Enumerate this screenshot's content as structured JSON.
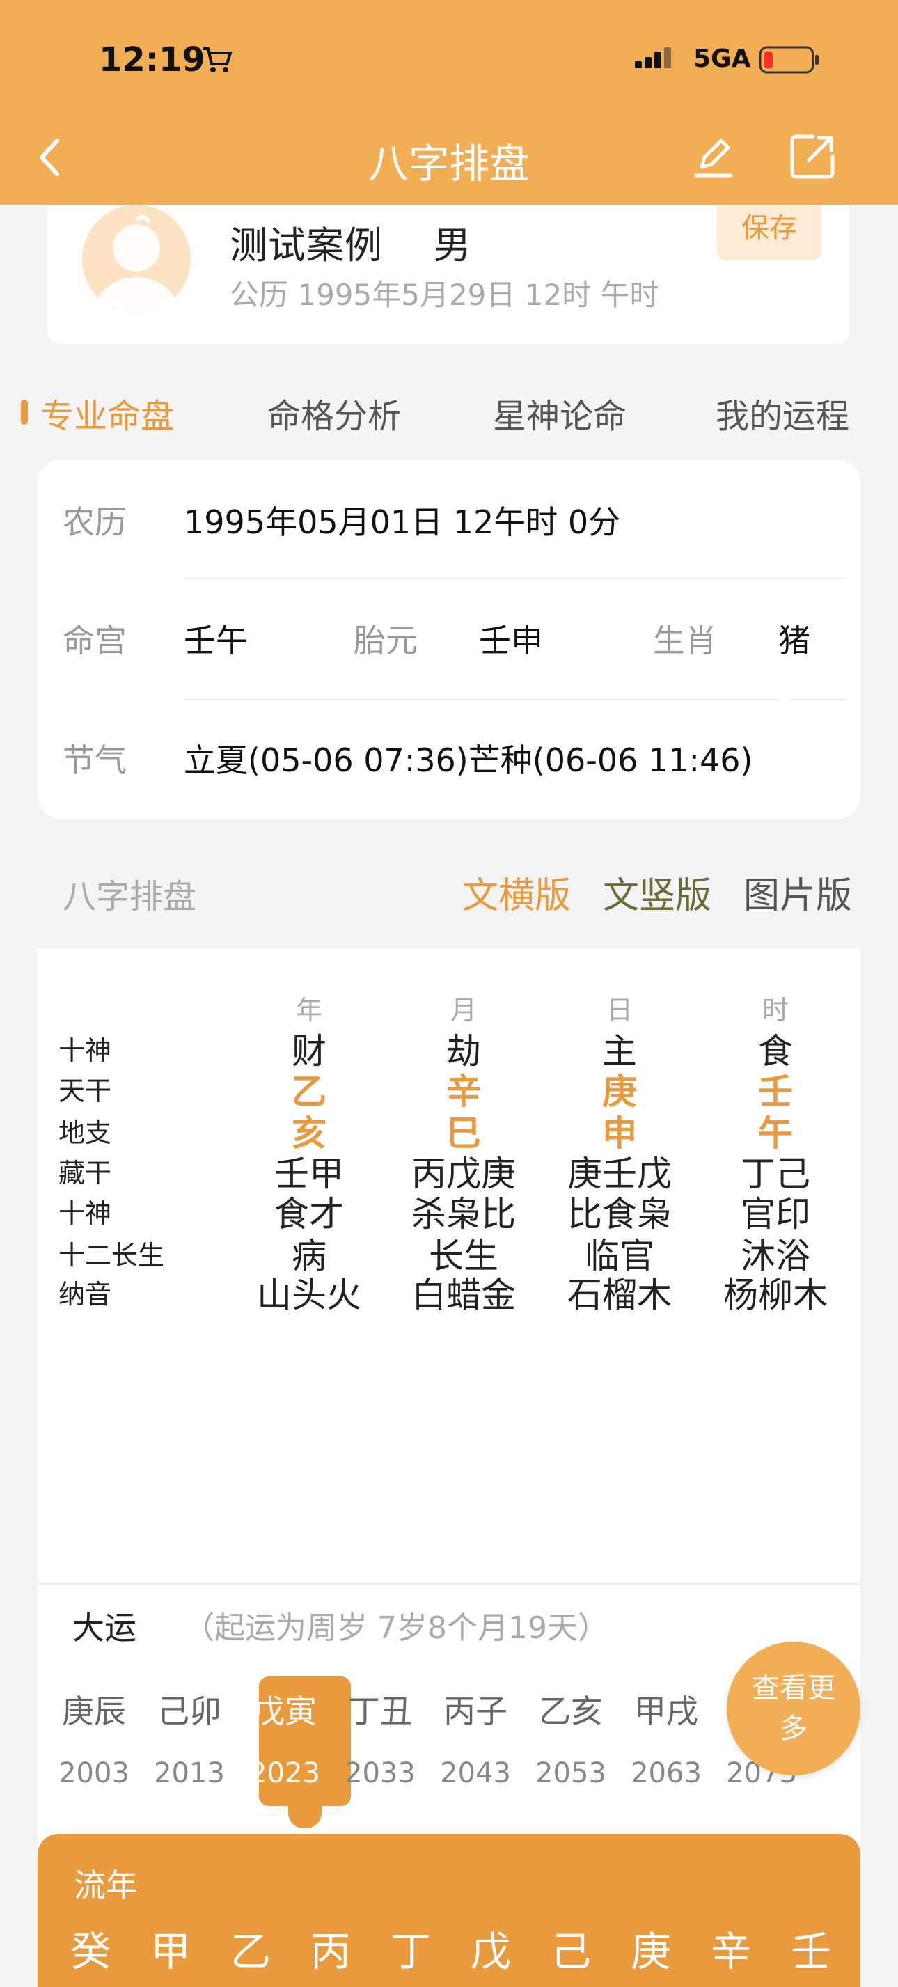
{
  "status": {
    "time": "12:19",
    "network": "5GA"
  },
  "header": {
    "title": "八字排盘"
  },
  "profile": {
    "name": "测试案例",
    "gender": "男",
    "birth": "公历 1995年5月29日 12时 午时",
    "save_label": "保存"
  },
  "tabs": [
    "专业命盘",
    "命格分析",
    "星神论命",
    "我的运程"
  ],
  "info": {
    "lunar_label": "农历",
    "lunar_value": "1995年05月01日 12午时 0分",
    "minggong_label": "命宫",
    "minggong_value": "壬午",
    "taiyuan_label": "胎元",
    "taiyuan_value": "壬申",
    "zodiac_label": "生肖",
    "zodiac_value": "猪",
    "jieqi_label": "节气",
    "jieqi_value": "立夏(05-06 07:36)芒种(06-06 11:46)"
  },
  "bazi_section": {
    "title": "八字排盘",
    "views": [
      "文横版",
      "文竖版",
      "图片版"
    ]
  },
  "bazi": {
    "columns": [
      "年",
      "月",
      "日",
      "时"
    ],
    "rows": [
      {
        "label": "十神",
        "cells": [
          "财",
          "劫",
          "主",
          "食"
        ],
        "highlight": false
      },
      {
        "label": "天干",
        "cells": [
          "乙",
          "辛",
          "庚",
          "壬"
        ],
        "highlight": true
      },
      {
        "label": "地支",
        "cells": [
          "亥",
          "巳",
          "申",
          "午"
        ],
        "highlight": true
      },
      {
        "label": "藏干",
        "cells": [
          "壬甲",
          "丙戊庚",
          "庚壬戊",
          "丁己"
        ],
        "highlight": false
      },
      {
        "label": "十神",
        "cells": [
          "食才",
          "杀枭比",
          "比食枭",
          "官印"
        ],
        "highlight": false
      },
      {
        "label": "十二长生",
        "cells": [
          "病",
          "长生",
          "临官",
          "沐浴"
        ],
        "highlight": false
      },
      {
        "label": "纳音",
        "cells": [
          "山头火",
          "白蜡金",
          "石榴木",
          "杨柳木"
        ],
        "highlight": false
      }
    ]
  },
  "dayun": {
    "title": "大运",
    "note": "（起运为周岁 7岁8个月19天）",
    "items": [
      {
        "gz": "庚辰",
        "year": "2003"
      },
      {
        "gz": "己卯",
        "year": "2013"
      },
      {
        "gz": "戊寅",
        "year": "2023"
      },
      {
        "gz": "丁丑",
        "year": "2033"
      },
      {
        "gz": "丙子",
        "year": "2043"
      },
      {
        "gz": "乙亥",
        "year": "2053"
      },
      {
        "gz": "甲戌",
        "year": "2063"
      },
      {
        "gz": "",
        "year": "2073"
      }
    ],
    "selected_index": 2,
    "more_label": "查看更多"
  },
  "liunian": {
    "title": "流年",
    "gan": [
      "癸",
      "甲",
      "乙",
      "丙",
      "丁",
      "戊",
      "己",
      "庚",
      "辛",
      "壬"
    ]
  },
  "colors": {
    "header_bg": "#f2ae55",
    "accent": "#e89a3c",
    "ver_second": "#6b6b3a"
  }
}
